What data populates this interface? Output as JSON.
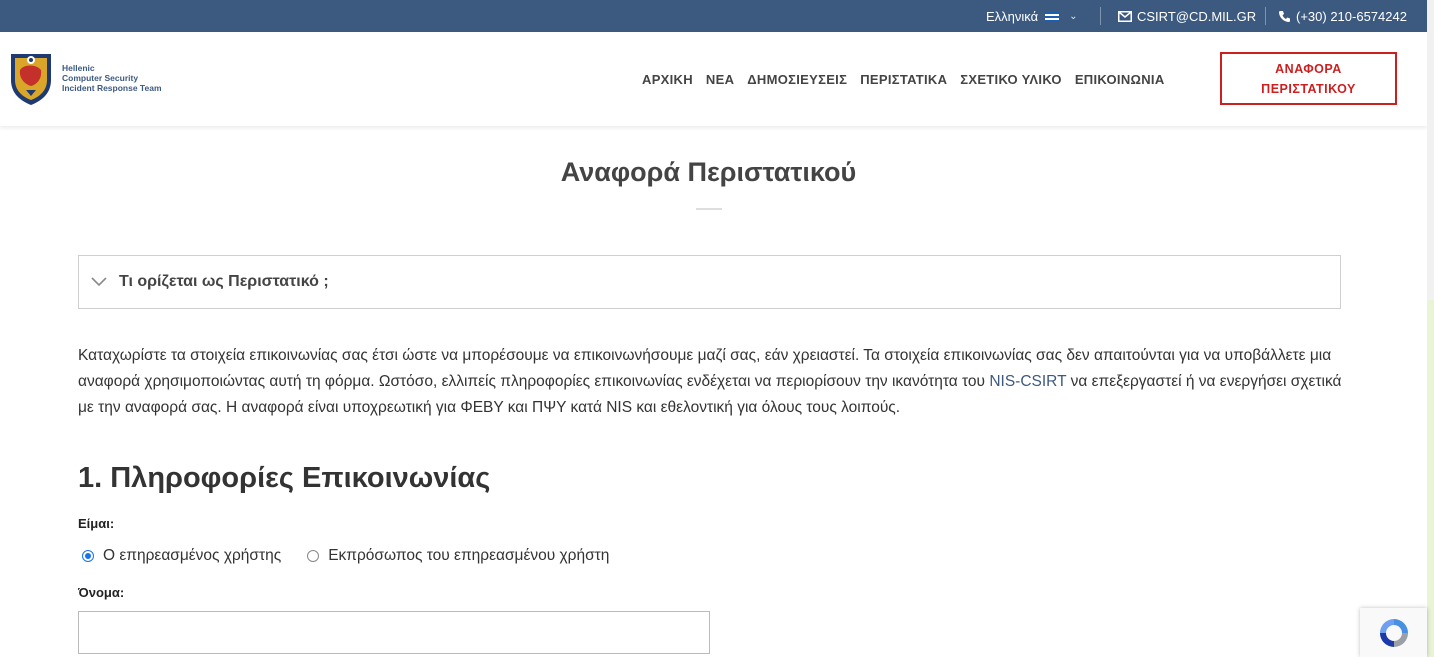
{
  "topbar": {
    "language": "Ελληνικά",
    "email": "CSIRT@CD.MIL.GR",
    "phone": "(+30) 210-6574242",
    "icons": [
      "flag-icon",
      "chevron-down-icon",
      "mail-icon",
      "phone-icon"
    ]
  },
  "header": {
    "logo_lines": [
      "Hellenic",
      "Computer Security",
      "Incident Response Team"
    ],
    "nav": [
      "ΑΡΧΙΚΗ",
      "ΝΕΑ",
      "ΔΗΜΟΣΙΕΥΣΕΙΣ",
      "ΠΕΡΙΣΤΑΤΙΚΑ",
      "ΣΧΕΤΙΚΟ ΥΛΙΚΟ",
      "ΕΠΙΚΟΙΝΩΝΙΑ"
    ],
    "cta": "ΑΝΑΦΟΡΑ ΠΕΡΙΣΤΑΤΙΚΟΥ"
  },
  "page": {
    "title": "Αναφορά Περιστατικού",
    "accordion_title": "Τι ορίζεται ως Περιστατικό ;",
    "intro_1": "Καταχωρίστε τα στοιχεία επικοινωνίας σας έτσι ώστε να μπορέσουμε να επικοινωνήσουμε μαζί σας, εάν χρειαστεί. Τα στοιχεία επικοινωνίας σας δεν απαιτούνται για να υποβάλλετε μια αναφορά χρησιμοποιώντας αυτή τη φόρμα. Ωστόσο, ελλιπείς πληροφορίες επικοινωνίας ενδέχεται να περιορίσουν την ικανότητα του ",
    "intro_link": "NIS-CSIRT",
    "intro_2": " να επεξεργαστεί ή να ενεργήσει σχετικά με την αναφορά σας. Η αναφορά είναι υποχρεωτική για ΦΕΒΥ και ΠΨΥ κατά NIS και εθελοντική για όλους τους λοιπούς."
  },
  "form": {
    "section_heading": "1. Πληροφορίες Επικοινωνίας",
    "iam_label": "Είμαι:",
    "radio_options": [
      "Ο επηρεασμένος χρήστης",
      "Εκπρόσωπος του επηρεασμένου χρήστη"
    ],
    "selected_radio": 0,
    "name_label": "Όνομα:",
    "name_value": ""
  },
  "colors": {
    "topbar": "#3c5a80",
    "cta": "#cc1f1f",
    "radio_accent": "#1a73e8"
  }
}
